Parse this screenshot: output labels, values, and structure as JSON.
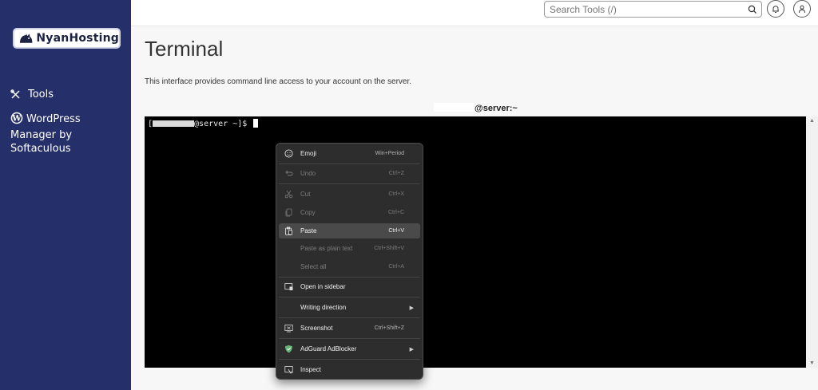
{
  "sidebar": {
    "logo_text": "NyanHosting",
    "items": [
      {
        "label": "Tools"
      },
      {
        "label_lines": [
          "WordPress",
          "Manager by",
          "Softaculous"
        ]
      }
    ]
  },
  "header": {
    "search_placeholder": "Search Tools (/)"
  },
  "page": {
    "title": "Terminal",
    "description": "This interface provides command line access to your account on the server.",
    "terminal_title": "@server:~",
    "prompt_prefix": "[",
    "prompt_suffix": "@server ~]$"
  },
  "context_menu": {
    "items": [
      {
        "label": "Emoji",
        "shortcut": "Win+Period",
        "icon": "smiley-icon"
      },
      {
        "label": "Undo",
        "shortcut": "Ctrl+Z",
        "icon": "undo-icon"
      },
      {
        "label": "Cut",
        "shortcut": "Ctrl+X",
        "icon": "scissors-icon"
      },
      {
        "label": "Copy",
        "shortcut": "Ctrl+C",
        "icon": "copy-icon"
      },
      {
        "label": "Paste",
        "shortcut": "Ctrl+V",
        "icon": "paste-icon"
      },
      {
        "label": "Paste as plain text",
        "shortcut": "Ctrl+Shift+V"
      },
      {
        "label": "Select all",
        "shortcut": "Ctrl+A"
      },
      {
        "label": "Open in sidebar",
        "icon": "sidebar-icon"
      },
      {
        "label": "Writing direction"
      },
      {
        "label": "Screenshot",
        "shortcut": "Ctrl+Shift+Z",
        "icon": "screenshot-icon"
      },
      {
        "label": "AdGuard AdBlocker",
        "icon": "adguard-shield-icon"
      },
      {
        "label": "Inspect",
        "icon": "inspect-icon"
      }
    ]
  },
  "colors": {
    "sidebar_bg": "#25306a",
    "terminal_bg": "#000000",
    "menu_bg": "#2d2d2d",
    "menu_highlight": "#4a4a4a",
    "adguard_green": "#67b279"
  }
}
